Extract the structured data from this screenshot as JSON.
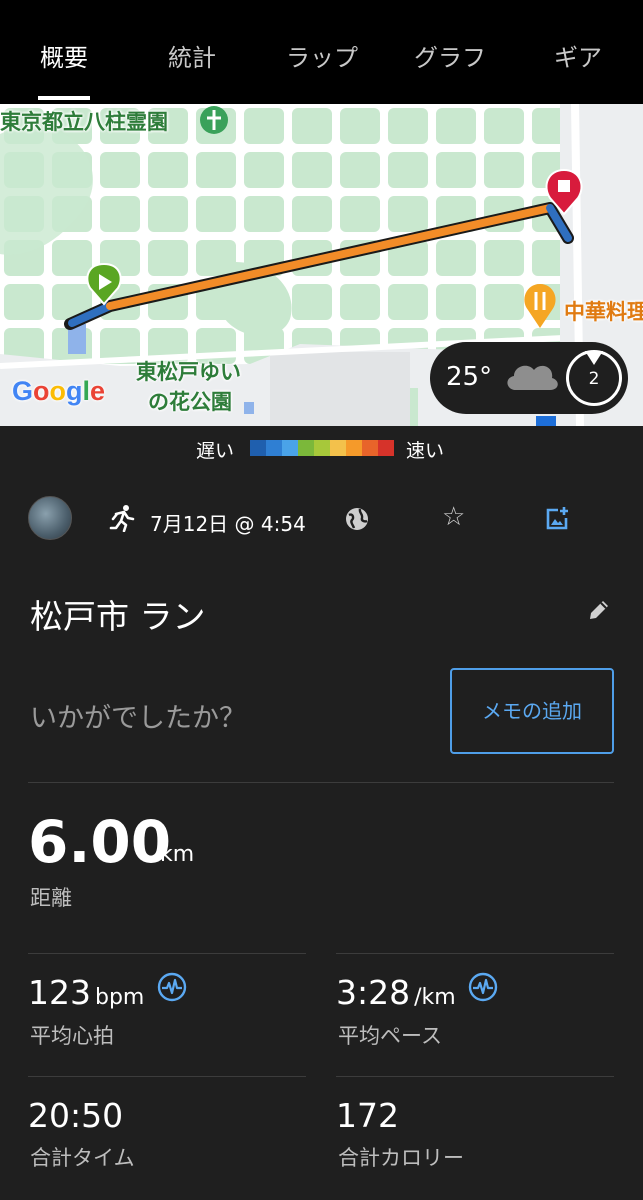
{
  "tabs": [
    {
      "label": "概要",
      "active": true
    },
    {
      "label": "統計",
      "active": false
    },
    {
      "label": "ラップ",
      "active": false
    },
    {
      "label": "グラフ",
      "active": false
    },
    {
      "label": "ギア",
      "active": false
    }
  ],
  "map": {
    "labels": {
      "cemetery": "東京都立八柱霊園",
      "park_line1": "東松戸ゆい",
      "park_line2": "の花公園",
      "restaurant": "中華料理"
    },
    "google_logo": "Google",
    "weather": {
      "temperature": "25°",
      "wind": "2"
    }
  },
  "legend": {
    "slow": "遅い",
    "fast": "速い",
    "colors": [
      "#1f5fae",
      "#2f7fd3",
      "#4aa3e8",
      "#7bb83a",
      "#a7c83a",
      "#f3c14b",
      "#f59a2a",
      "#e8642a",
      "#d6332a"
    ]
  },
  "activity": {
    "date": "7月12日 @ 4:54",
    "title": "松戸市 ラン",
    "prompt": "いかがでしたか？",
    "memo_button": "メモの追加"
  },
  "stats": {
    "distance": {
      "value": "6.00",
      "unit": "km",
      "label": "距離"
    },
    "heart_rate": {
      "value": "123",
      "unit": "bpm",
      "label": "平均心拍"
    },
    "pace": {
      "value": "3:28",
      "unit": "/km",
      "label": "平均ペース"
    },
    "time": {
      "value": "20:50",
      "label": "合計タイム"
    },
    "calories": {
      "value": "172",
      "label": "合計カロリー"
    }
  },
  "colors": {
    "accent": "#4f9ee8",
    "background": "#1f1f1f",
    "route": "#f28c28"
  }
}
